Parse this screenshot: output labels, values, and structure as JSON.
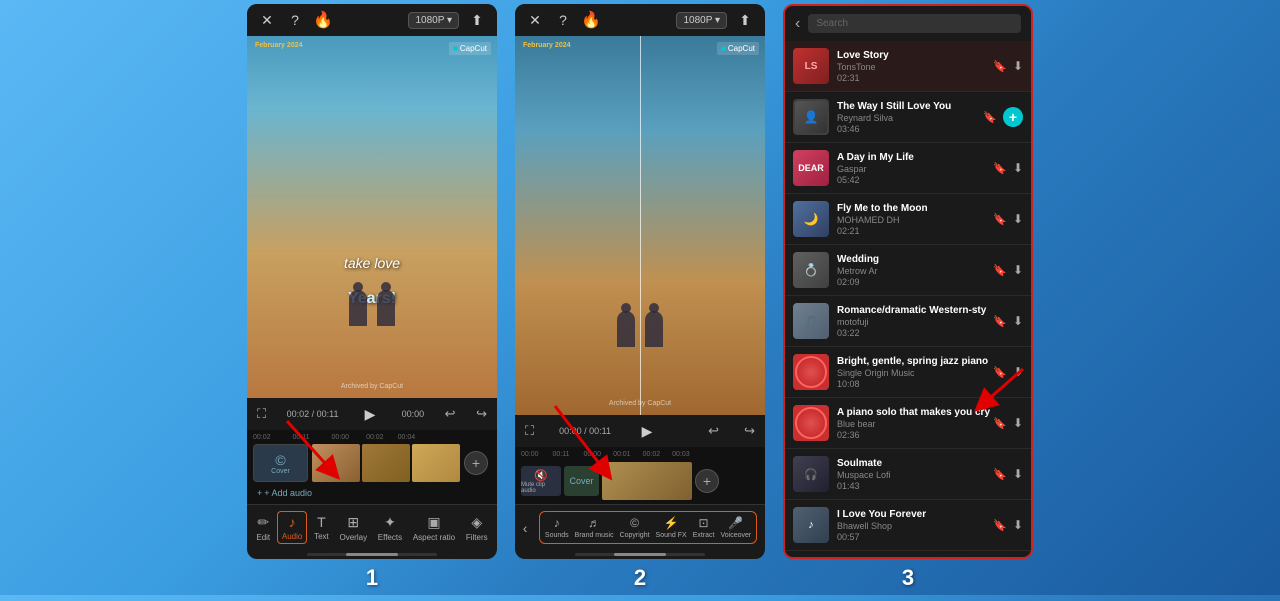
{
  "panels": [
    {
      "id": "panel1",
      "step": "1",
      "top_bar": {
        "close": "✕",
        "help": "?",
        "fire": "🔥",
        "resolution": "1080P ▾",
        "export": "⬆"
      },
      "video": {
        "date": "February",
        "date_year": "2024",
        "watermark": "CapCut",
        "text_line1": "take love",
        "text_line2": "Years!",
        "archived": "Archived by CapCut"
      },
      "timeline": {
        "add_audio": "+ Add audio"
      },
      "toolbar": [
        {
          "id": "edit",
          "icon": "✏",
          "label": "Edit"
        },
        {
          "id": "audio",
          "icon": "♪",
          "label": "Audio",
          "active": true
        },
        {
          "id": "text",
          "icon": "T",
          "label": "Text"
        },
        {
          "id": "overlay",
          "icon": "⊞",
          "label": "Overlay"
        },
        {
          "id": "effects",
          "icon": "✦",
          "label": "Effects"
        },
        {
          "id": "aspect",
          "icon": "▣",
          "label": "Aspect ratio"
        },
        {
          "id": "filters",
          "icon": "◈",
          "label": "Filters"
        }
      ]
    },
    {
      "id": "panel2",
      "step": "2",
      "top_bar": {
        "close": "✕",
        "help": "?",
        "fire": "🔥",
        "resolution": "1080P ▾",
        "export": "⬆"
      },
      "video": {
        "date": "February",
        "date_year": "2024",
        "watermark": "CapCut",
        "archived": "Archived by CapCut"
      },
      "audio_toolbar": [
        {
          "id": "sounds",
          "icon": "♪",
          "label": "Sounds"
        },
        {
          "id": "brand",
          "icon": "♬",
          "label": "Brand music"
        },
        {
          "id": "copyright",
          "icon": "©",
          "label": "Copyright"
        },
        {
          "id": "sound_fx",
          "icon": "⚡",
          "label": "Sound FX"
        },
        {
          "id": "extract",
          "icon": "⊡",
          "label": "Extract"
        },
        {
          "id": "voiceover",
          "icon": "🎤",
          "label": "Voiceover"
        }
      ]
    }
  ],
  "music_panel": {
    "step": "3",
    "back": "‹",
    "search_placeholder": "Search",
    "tracks": [
      {
        "id": "love-story",
        "title": "Love Story",
        "artist": "TonsTone",
        "duration": "02:31",
        "active": true,
        "thumb_bg": "#c03030",
        "thumb_text": "LS"
      },
      {
        "id": "way-still-love",
        "title": "The Way I Still Love You",
        "artist": "Reynard Silva",
        "duration": "03:46",
        "active": false,
        "has_add": true,
        "thumb_bg": "#404040",
        "thumb_text": "♫"
      },
      {
        "id": "day-in-life",
        "title": "A Day in My Life",
        "artist": "Gaspar",
        "duration": "05:42",
        "active": false,
        "thumb_bg": "#e04060",
        "thumb_text": "♪"
      },
      {
        "id": "fly-me-moon",
        "title": "Fly Me to the Moon",
        "artist": "MOHAMED DH",
        "duration": "02:21",
        "active": false,
        "thumb_bg": "#607090",
        "thumb_text": "✦"
      },
      {
        "id": "wedding",
        "title": "Wedding",
        "artist": "Metrow Ar",
        "duration": "02:09",
        "active": false,
        "thumb_bg": "#505050",
        "thumb_text": "♡"
      },
      {
        "id": "romance-dramatic",
        "title": "Romance/dramatic Western-sty",
        "artist": "motofuji",
        "duration": "03:22",
        "active": false,
        "thumb_bg": "#708090",
        "thumb_text": "♬"
      },
      {
        "id": "bright-gentle",
        "title": "Bright, gentle, spring jazz piano",
        "artist": "Single Origin Music",
        "duration": "10:08",
        "active": false,
        "thumb_bg": "#c83030",
        "thumb_text": "●"
      },
      {
        "id": "piano-solo",
        "title": "A piano solo that makes you cry",
        "artist": "Blue bear",
        "duration": "02:36",
        "active": false,
        "thumb_bg": "#c83030",
        "thumb_text": "●"
      },
      {
        "id": "soulmate",
        "title": "Soulmate",
        "artist": "Muspace Lofi",
        "duration": "01:43",
        "active": false,
        "thumb_bg": "#404050",
        "thumb_text": "♫"
      },
      {
        "id": "i-love-forever",
        "title": "I Love You Forever",
        "artist": "Bhawell Shop",
        "duration": "00:57",
        "active": false,
        "thumb_bg": "#506070",
        "thumb_text": "♪"
      }
    ]
  }
}
